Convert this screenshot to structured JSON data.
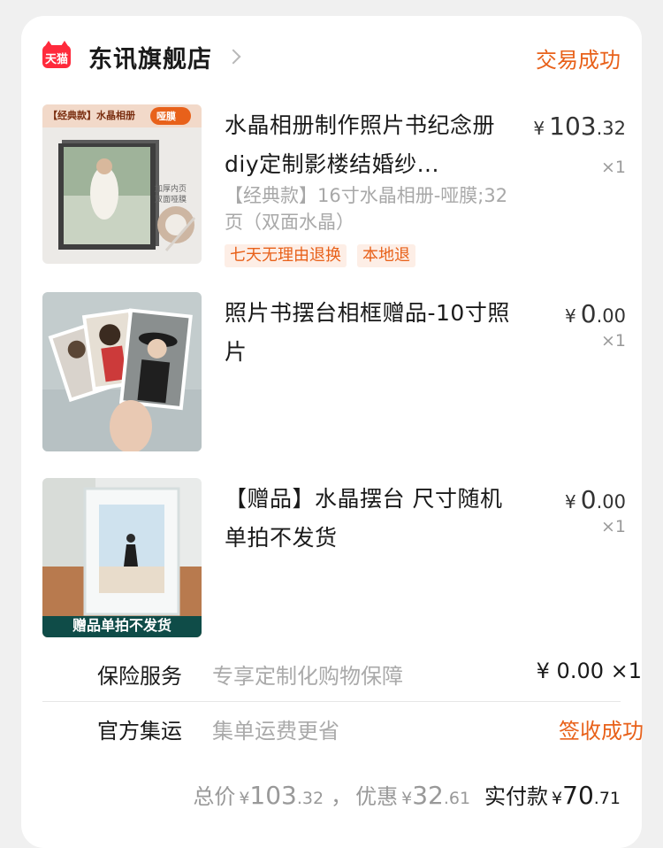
{
  "store": {
    "icon_text": "天猫",
    "name": "东讯旗舰店",
    "status": "交易成功"
  },
  "items": [
    {
      "title": "水晶相册制作照片书纪念册diy定制影楼结婚纱...",
      "spec": "【经典款】16寸水晶相册-哑膜;32页（双面水晶）",
      "price_currency": "¥",
      "price_int": "103",
      "price_dec": ".32",
      "quantity": "×1",
      "tags": [
        "七天无理由退换",
        "本地退"
      ],
      "thumb_texts": {
        "banner_left": "【经典款】水晶相册",
        "banner_right": "哑膜",
        "side_note_1": "加厚内页",
        "side_note_2": "双面哑膜"
      }
    },
    {
      "title": "照片书摆台相框赠品-10寸照片",
      "price_currency": "¥",
      "price_int": "0",
      "price_dec": ".00",
      "quantity": "×1"
    },
    {
      "title": "【赠品】水晶摆台  尺寸随机  单拍不发货",
      "price_currency": "¥",
      "price_int": "0",
      "price_dec": ".00",
      "quantity": "×1",
      "thumb_caption": "赠品单拍不发货"
    }
  ],
  "insurance": {
    "label": "保险服务",
    "desc": "专享定制化购物保障",
    "value": "¥ 0.00 ×1"
  },
  "shipping": {
    "label": "官方集运",
    "desc": "集单运费更省",
    "status": "签收成功"
  },
  "totals": {
    "total_label": "总价",
    "total_currency": "¥",
    "total_int": "103",
    "total_dec": ".32",
    "separator": "，",
    "discount_label": "优惠",
    "discount_currency": "¥",
    "discount_int": "32",
    "discount_dec": ".61",
    "paid_label": "实付款",
    "paid_currency": "¥",
    "paid_int": "70",
    "paid_dec": ".71"
  },
  "colors": {
    "accent": "#e8611a",
    "tmall_red": "#ff2a3c",
    "tag_bg": "#fdeee6",
    "muted": "#999999"
  }
}
